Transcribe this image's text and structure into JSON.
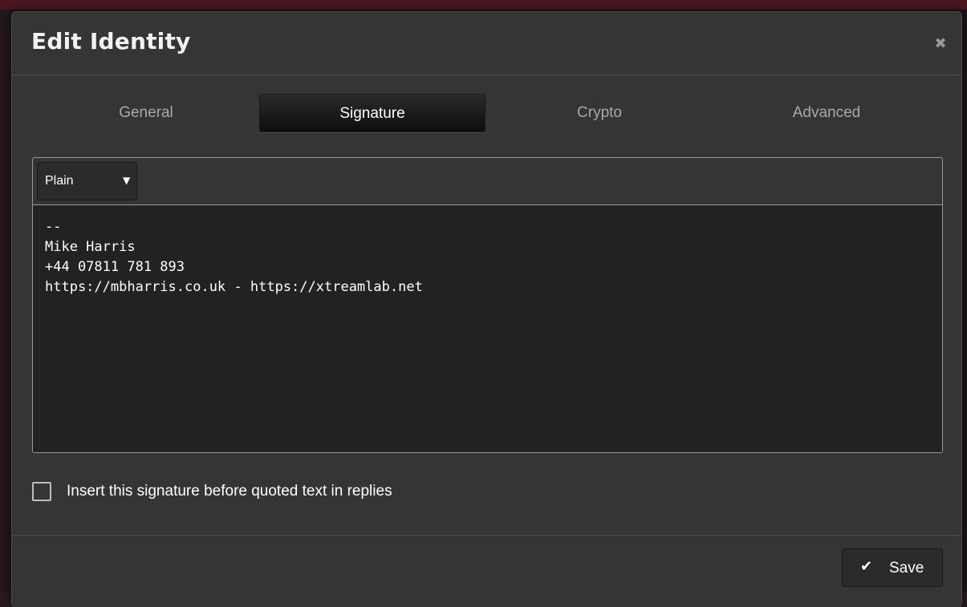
{
  "dialog": {
    "title": "Edit Identity",
    "close_icon": "close-icon"
  },
  "tabs": [
    {
      "label": "General",
      "active": false
    },
    {
      "label": "Signature",
      "active": true
    },
    {
      "label": "Crypto",
      "active": false
    },
    {
      "label": "Advanced",
      "active": false
    }
  ],
  "editor": {
    "format": "Plain",
    "format_icon": "caret-down-icon",
    "signature": "--\nMike Harris\n+44 07811 781 893\nhttps://mbharris.co.uk - https://xtreamlab.net"
  },
  "options": {
    "insert_before_quoted_label": "Insert this signature before quoted text in replies",
    "insert_before_quoted_checked": false
  },
  "footer": {
    "save_label": "Save",
    "save_icon": "checkmark-icon"
  },
  "colors": {
    "modal_bg": "#353535",
    "editor_bg": "#222222",
    "active_tab_bg": "#0e0e0e",
    "text": "#ffffff",
    "muted_text": "#a9a9a9"
  }
}
